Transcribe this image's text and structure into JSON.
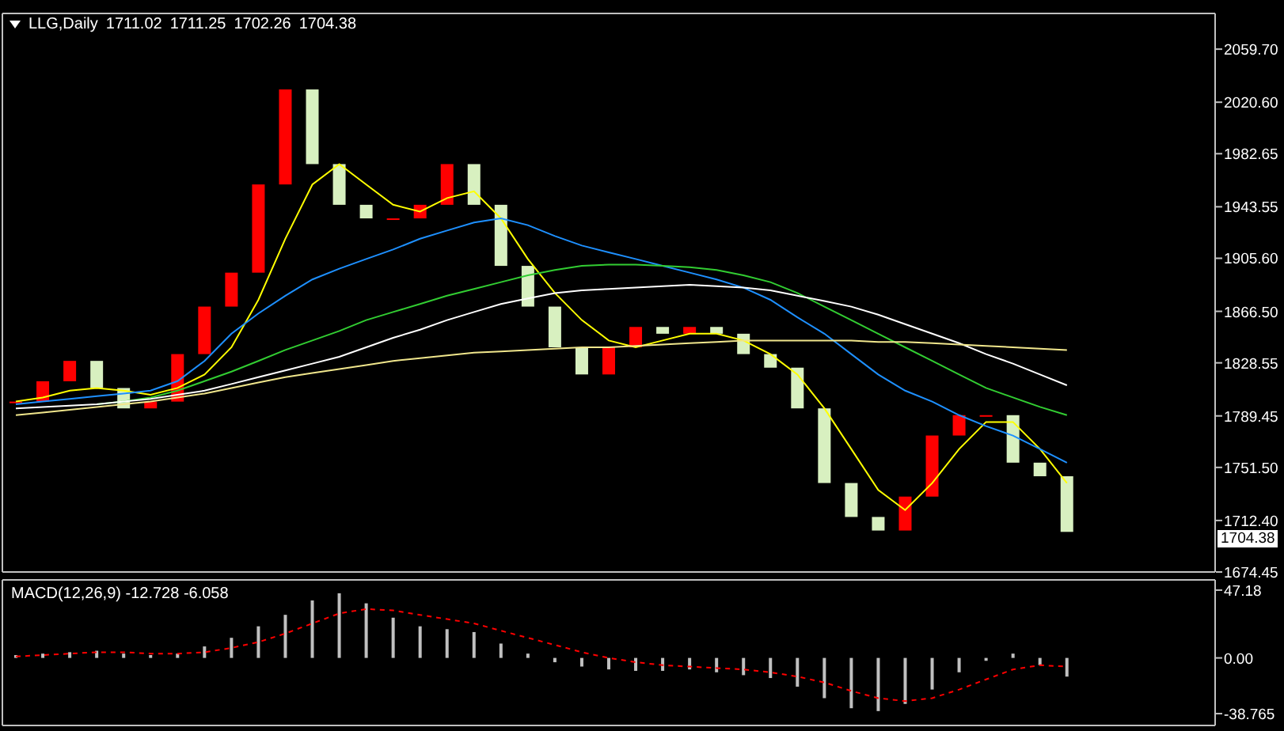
{
  "chart_header": {
    "symbol": "LLG,Daily",
    "ohlc": [
      "1711.02",
      "1711.25",
      "1702.26",
      "1704.38"
    ]
  },
  "price_chart": {
    "current_price": "1704.38",
    "chart_data": {
      "type": "line",
      "categories": [
        null,
        null,
        null,
        null,
        null,
        null,
        null,
        null,
        null,
        null,
        null,
        null,
        null,
        null,
        null,
        null,
        null,
        null,
        null,
        null,
        null,
        null,
        null,
        null,
        null,
        null,
        null,
        null,
        null,
        null,
        null,
        null,
        null,
        null,
        null,
        null,
        null,
        null,
        null,
        null,
        null,
        null,
        null,
        null,
        null
      ],
      "ylim": [
        1674.45,
        2086.0
      ],
      "yticks": [
        {
          "value": 2059.7,
          "label": "2059.70"
        },
        {
          "value": 2020.6,
          "label": "2020.60"
        },
        {
          "value": 1982.65,
          "label": "1982.65"
        },
        {
          "value": 1943.55,
          "label": "1943.55"
        },
        {
          "value": 1905.6,
          "label": "1905.60"
        },
        {
          "value": 1866.5,
          "label": "1866.50"
        },
        {
          "value": 1828.55,
          "label": "1828.55"
        },
        {
          "value": 1789.45,
          "label": "1789.45"
        },
        {
          "value": 1751.5,
          "label": "1751.50"
        },
        {
          "value": 1712.4,
          "label": "1712.40"
        },
        {
          "value": 1674.45,
          "label": "1674.45"
        }
      ],
      "series": [
        {
          "color": "#ffff00",
          "values": [
            1800,
            1803,
            1808,
            1810,
            1808,
            1805,
            1810,
            1820,
            1840,
            1875,
            1920,
            1960,
            1975,
            1960,
            1945,
            1940,
            1950,
            1955,
            1935,
            1905,
            1880,
            1860,
            1845,
            1840,
            1845,
            1850,
            1850,
            1845,
            1835,
            1820,
            1795,
            1765,
            1735,
            1720,
            1740,
            1765,
            1785,
            1785,
            1765,
            1740,
            null,
            null,
            null,
            null,
            null
          ]
        },
        {
          "color": "#1e90ff",
          "values": [
            1798,
            1800,
            1802,
            1804,
            1806,
            1808,
            1815,
            1830,
            1850,
            1865,
            1878,
            1890,
            1898,
            1905,
            1912,
            1920,
            1926,
            1932,
            1935,
            1930,
            1922,
            1915,
            1910,
            1905,
            1900,
            1895,
            1890,
            1884,
            1875,
            1862,
            1850,
            1835,
            1820,
            1808,
            1800,
            1790,
            1782,
            1775,
            1765,
            1755,
            null,
            null,
            null,
            null,
            null
          ]
        },
        {
          "color": "#32cd32",
          "values": [
            null,
            null,
            null,
            1798,
            1800,
            1803,
            1808,
            1815,
            1822,
            1830,
            1838,
            1845,
            1852,
            1860,
            1866,
            1872,
            1878,
            1883,
            1888,
            1893,
            1897,
            1900,
            1901,
            1901,
            1900,
            1899,
            1897,
            1893,
            1888,
            1880,
            1870,
            1860,
            1850,
            1840,
            1830,
            1820,
            1810,
            1803,
            1796,
            1790,
            null,
            null,
            null,
            null,
            null
          ]
        },
        {
          "color": "#ffffff",
          "values": [
            1795,
            1796,
            1797,
            1798,
            1800,
            1802,
            1805,
            1808,
            1813,
            1818,
            1823,
            1828,
            1833,
            1840,
            1847,
            1853,
            1860,
            1866,
            1872,
            1876,
            1880,
            1882,
            1883,
            1884,
            1885,
            1886,
            1885,
            1884,
            1882,
            1878,
            1874,
            1870,
            1864,
            1857,
            1850,
            1843,
            1835,
            1828,
            1820,
            1812,
            null,
            null,
            null,
            null,
            null
          ]
        },
        {
          "color": "#f0e68c",
          "values": [
            1790,
            1792,
            1794,
            1796,
            1798,
            1800,
            1803,
            1806,
            1810,
            1814,
            1818,
            1821,
            1824,
            1827,
            1830,
            1832,
            1834,
            1836,
            1837,
            1838,
            1839,
            1840,
            1840,
            1841,
            1842,
            1843,
            1844,
            1845,
            1845,
            1845,
            1845,
            1845,
            1844,
            1844,
            1843,
            1842,
            1841,
            1840,
            1839,
            1838,
            null,
            null,
            null,
            null,
            null
          ]
        }
      ]
    }
  },
  "macd_panel": {
    "label": "MACD(12,26,9) -12.728 -6.058",
    "chart_data": {
      "type": "bar",
      "categories": [
        null,
        null,
        null,
        null,
        null,
        null,
        null,
        null,
        null,
        null,
        null,
        null,
        null,
        null,
        null,
        null,
        null,
        null,
        null,
        null,
        null,
        null,
        null,
        null,
        null,
        null,
        null,
        null,
        null,
        null,
        null,
        null,
        null,
        null,
        null,
        null,
        null,
        null,
        null,
        null,
        null,
        null,
        null,
        null,
        null
      ],
      "ylim": [
        -47.0,
        54.3
      ],
      "yticks": [
        {
          "value": 47.18,
          "label": "47.18"
        },
        {
          "value": 0,
          "label": "0.00"
        },
        {
          "value": -38.765,
          "label": "-38.765"
        }
      ],
      "series": [
        {
          "color": "#c0c0c0",
          "values": [
            2,
            3,
            4,
            5,
            3,
            2,
            3,
            8,
            14,
            22,
            30,
            40,
            45,
            38,
            28,
            22,
            20,
            18,
            10,
            3,
            -3,
            -6,
            -8,
            -9,
            -9,
            -8,
            -10,
            -12,
            -14,
            -20,
            -28,
            -35,
            -37,
            -32,
            -22,
            -10,
            -2,
            3,
            -5,
            -13,
            null,
            null,
            null,
            null,
            null
          ]
        },
        {
          "type": "line",
          "line_style": "dashed",
          "color": "#ff0000",
          "values": [
            1,
            2,
            3,
            4,
            4,
            3,
            3,
            4,
            7,
            11,
            17,
            24,
            31,
            34,
            33,
            30,
            27,
            24,
            19,
            14,
            9,
            4,
            0,
            -3,
            -5,
            -6,
            -7,
            -8,
            -10,
            -13,
            -17,
            -23,
            -28,
            -30,
            -28,
            -22,
            -15,
            -8,
            -5,
            -6,
            null,
            null,
            null,
            null,
            null
          ]
        }
      ]
    }
  }
}
